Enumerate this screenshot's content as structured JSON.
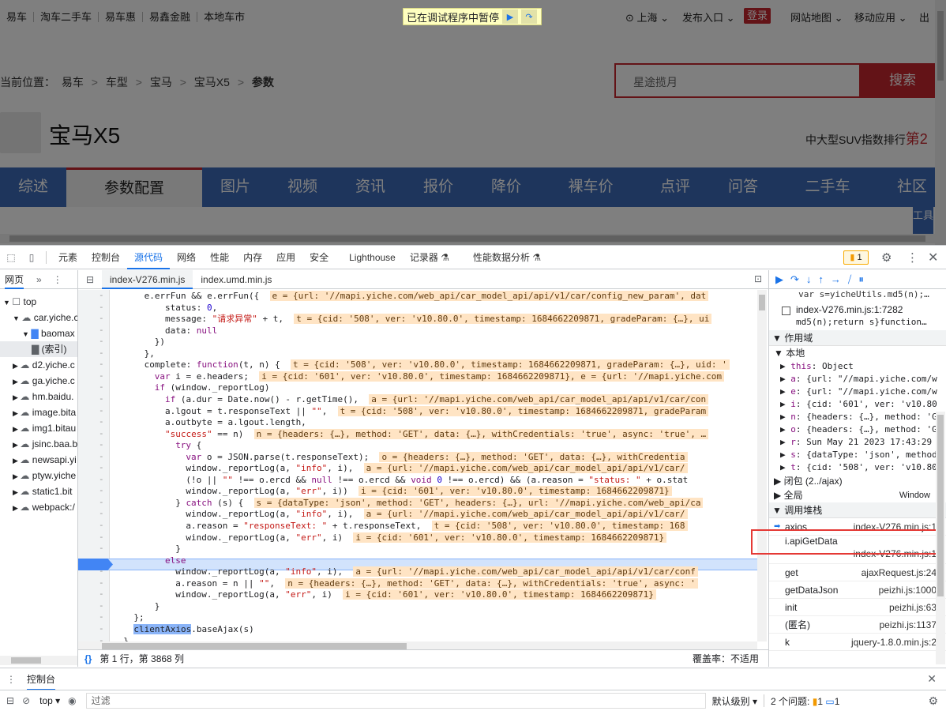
{
  "site": {
    "topnav": [
      "易车",
      "淘车二手车",
      "易车惠",
      "易鑫金融",
      "本地车市"
    ],
    "pause_banner": "已在调试程序中暂停",
    "city": "上海",
    "publish": "发布入口",
    "login": "登录",
    "sitemap": "网站地图",
    "mobile": "移动应用",
    "exit": "出",
    "breadcrumb": {
      "label": "当前位置：",
      "items": [
        "易车",
        "车型",
        "宝马",
        "宝马X5"
      ],
      "current": "参数",
      "sep": ">"
    },
    "search_value": "星途揽月",
    "search_button": "搜索",
    "car_title": "宝马X5",
    "rank_text": "中大型SUV指数排行",
    "rank_value": "第2",
    "tabs": [
      "综述",
      "参数配置",
      "图片",
      "视频",
      "资讯",
      "报价",
      "降价",
      "裸车价",
      "点评",
      "问答",
      "二手车",
      "社区"
    ],
    "active_tab": "参数配置",
    "float_button": "工具"
  },
  "devtools": {
    "panels": [
      "元素",
      "控制台",
      "源代码",
      "网络",
      "性能",
      "内存",
      "应用",
      "安全",
      "Lighthouse",
      "记录器",
      "性能数据分析"
    ],
    "active_panel": "源代码",
    "issues_badge": "1",
    "navigator_tab": "网页",
    "tree": [
      {
        "label": "top",
        "depth": 0,
        "arrow": "▼",
        "icon": "☐"
      },
      {
        "label": "car.yiche.c",
        "depth": 1,
        "arrow": "▼",
        "icon": "☁"
      },
      {
        "label": "baomax",
        "depth": 2,
        "arrow": "▼",
        "icon": "▇"
      },
      {
        "label": "(索引)",
        "depth": 3,
        "arrow": "",
        "icon": "▇"
      },
      {
        "label": "d2.yiche.c",
        "depth": 1,
        "arrow": "▶",
        "icon": "☁"
      },
      {
        "label": "ga.yiche.c",
        "depth": 1,
        "arrow": "▶",
        "icon": "☁"
      },
      {
        "label": "hm.baidu.",
        "depth": 1,
        "arrow": "▶",
        "icon": "☁"
      },
      {
        "label": "image.bita",
        "depth": 1,
        "arrow": "▶",
        "icon": "☁"
      },
      {
        "label": "img1.bitau",
        "depth": 1,
        "arrow": "▶",
        "icon": "☁"
      },
      {
        "label": "jsinc.baa.b",
        "depth": 1,
        "arrow": "▶",
        "icon": "☁"
      },
      {
        "label": "newsapi.yi",
        "depth": 1,
        "arrow": "▶",
        "icon": "☁"
      },
      {
        "label": "ptyw.yiche",
        "depth": 1,
        "arrow": "▶",
        "icon": "☁"
      },
      {
        "label": "static1.bit",
        "depth": 1,
        "arrow": "▶",
        "icon": "☁"
      },
      {
        "label": "webpack:/",
        "depth": 1,
        "arrow": "▶",
        "icon": "☁"
      }
    ],
    "file_tabs": [
      "index-V276.min.js",
      "index.umd.min.js"
    ],
    "code_lines": [
      {
        "indent": 6,
        "html": "e.errFun && e.errFun({  <span class='inline'>e = {url: '//mapi.yiche.com/web_api/car_model_api/api/v1/car/config_new_param', dat</span>"
      },
      {
        "indent": 10,
        "html": "status: <span class='num'>0</span>,"
      },
      {
        "indent": 10,
        "html": "message: <span class='str'>\"请求异常\"</span> + t,  <span class='inline'>t = {cid: '508', ver: 'v10.80.0', timestamp: 1684662209871, gradeParam: {…}, ui</span>"
      },
      {
        "indent": 10,
        "html": "data: <span class='kw'>null</span>"
      },
      {
        "indent": 8,
        "html": "})"
      },
      {
        "indent": 6,
        "html": "},"
      },
      {
        "indent": 6,
        "html": "complete: <span class='kw'>function</span>(t, n) {  <span class='inline'>t = {cid: '508', ver: 'v10.80.0', timestamp: 1684662209871, gradeParam: {…}, uid: '</span>"
      },
      {
        "indent": 8,
        "html": "<span class='kw'>var</span> i = e.headers;  <span class='inline'>i = {cid: '601', ver: 'v10.80.0', timestamp: 1684662209871}, e = {url: '//mapi.yiche.com</span>"
      },
      {
        "indent": 8,
        "html": "<span class='kw'>if</span> (window._reportLog)"
      },
      {
        "indent": 10,
        "html": "<span class='kw'>if</span> (a.dur = Date.now() - r.getTime(),  <span class='inline'>a = {url: '//mapi.yiche.com/web_api/car_model_api/api/v1/car/con</span>"
      },
      {
        "indent": 10,
        "html": "a.lgout = t.responseText || <span class='str'>\"\"</span>,  <span class='inline'>t = {cid: '508', ver: 'v10.80.0', timestamp: 1684662209871, gradeParam</span>"
      },
      {
        "indent": 10,
        "html": "a.outbyte = a.lgout.length,"
      },
      {
        "indent": 10,
        "html": "<span class='str'>\"success\"</span> == n)  <span class='inline'>n = {headers: {…}, method: 'GET', data: {…}, withCredentials: 'true', async: 'true', …</span>"
      },
      {
        "indent": 12,
        "html": "<span class='kw'>try</span> {"
      },
      {
        "indent": 14,
        "html": "<span class='kw'>var</span> o = JSON.parse(t.responseText);  <span class='inline'>o = {headers: {…}, method: 'GET', data: {…}, withCredentia</span>"
      },
      {
        "indent": 14,
        "html": "window._reportLog(a, <span class='str'>\"info\"</span>, i),  <span class='inline'>a = {url: '//mapi.yiche.com/web_api/car_model_api/api/v1/car/</span>"
      },
      {
        "indent": 14,
        "html": "(!o || <span class='str'>\"\"</span> !== o.ercd && <span class='kw'>null</span> !== o.ercd && <span class='kw'>void</span> <span class='num'>0</span> !== o.ercd) && (a.reason = <span class='str'>\"status: \"</span> + o.stat"
      },
      {
        "indent": 14,
        "html": "window._reportLog(a, <span class='str'>\"err\"</span>, i))  <span class='inline'>i = {cid: '601', ver: 'v10.80.0', timestamp: 1684662209871}</span>"
      },
      {
        "indent": 12,
        "html": "} <span class='kw'>catch</span> (s) {  <span class='inline'>s = {dataType: 'json', method: 'GET', headers: {…}, url: '//mapi.yiche.com/web_api/ca</span>"
      },
      {
        "indent": 14,
        "html": "window._reportLog(a, <span class='str'>\"info\"</span>, i),  <span class='inline'>a = {url: '//mapi.yiche.com/web_api/car_model_api/api/v1/car/</span>"
      },
      {
        "indent": 14,
        "html": "a.reason = <span class='str'>\"responseText: \"</span> + t.responseText,  <span class='inline'>t = {cid: '508', ver: 'v10.80.0', timestamp: 168</span>"
      },
      {
        "indent": 14,
        "html": "window._reportLog(a, <span class='str'>\"err\"</span>, i)  <span class='inline'>i = {cid: '601', ver: 'v10.80.0', timestamp: 1684662209871}</span>"
      },
      {
        "indent": 12,
        "html": "}"
      },
      {
        "indent": 10,
        "html": "<span class='kw'>else</span>"
      },
      {
        "indent": 12,
        "html": "window._reportLog(a, <span class='str'>\"info\"</span>, i),  <span class='inline'>a = {url: '//mapi.yiche.com/web_api/car_model_api/api/v1/car/conf</span>"
      },
      {
        "indent": 12,
        "html": "a.reason = n || <span class='str'>\"\"</span>,  <span class='inline'>n = {headers: {…}, method: 'GET', data: {…}, withCredentials: 'true', async: '</span>"
      },
      {
        "indent": 12,
        "html": "window._reportLog(a, <span class='str'>\"err\"</span>, i)  <span class='inline'>i = {cid: '601', ver: 'v10.80.0', timestamp: 1684662209871}</span>"
      },
      {
        "indent": 8,
        "html": "}"
      },
      {
        "indent": 4,
        "html": "};"
      },
      {
        "indent": 4,
        "html": "<span style='background:#8ab4f8'>clientAxios</span>.baseAjax(s)"
      },
      {
        "indent": 2,
        "html": "}"
      }
    ],
    "status_pos": "第 1 行，第 3868 列",
    "coverage": "覆盖率：不适用",
    "watch_rows": [
      {
        "expr": "index-V276.min.js:1:7282",
        "code": "md5(n);return s}function…"
      }
    ],
    "watch_prev": "var s=yicheUtils.md5(n);…",
    "scope_title": "作用域",
    "local_title": "本地",
    "scope_vars": [
      {
        "k": "this",
        "v": "Object"
      },
      {
        "k": "a",
        "v": "{url: \"//mapi.yiche.com/w"
      },
      {
        "k": "e",
        "v": "{url: \"//mapi.yiche.com/w"
      },
      {
        "k": "i",
        "v": "{cid: '601', ver: 'v10.80"
      },
      {
        "k": "n",
        "v": "{headers: {…}, method: 'G"
      },
      {
        "k": "o",
        "v": "{headers: {…}, method: 'G"
      },
      {
        "k": "r",
        "v": "Sun May 21 2023 17:43:29"
      },
      {
        "k": "s",
        "v": "{dataType: 'json', method"
      },
      {
        "k": "t",
        "v": "{cid: '508', ver: 'v10.80"
      }
    ],
    "closure": "闭包 (2../ajax)",
    "global": "全局",
    "global_val": "Window",
    "callstack_title": "调用堆栈",
    "callstack": [
      {
        "fn": "axios",
        "loc": "index-V276.min.js:1",
        "current": true
      },
      {
        "fn": "i.apiGetData",
        "loc": "index-V276.min.js:1",
        "current": false
      },
      {
        "fn": "get",
        "loc": "ajaxRequest.js:24",
        "current": false
      },
      {
        "fn": "getDataJson",
        "loc": "peizhi.js:1000",
        "current": false
      },
      {
        "fn": "init",
        "loc": "peizhi.js:63",
        "current": false
      },
      {
        "fn": "(匿名)",
        "loc": "peizhi.js:1137",
        "current": false
      },
      {
        "fn": "k",
        "loc": "jquery-1.8.0.min.js:2",
        "current": false
      }
    ],
    "drawer_tab": "控制台",
    "console_context": "top",
    "filter_placeholder": "过滤",
    "level": "默认级别",
    "issues_text": "2 个问题:",
    "issues_warn": "1",
    "issues_info": "1"
  },
  "colors": {
    "brand_red": "#c6262e",
    "tab_blue": "#3d6bb8",
    "devtools_blue": "#1a73e8"
  }
}
